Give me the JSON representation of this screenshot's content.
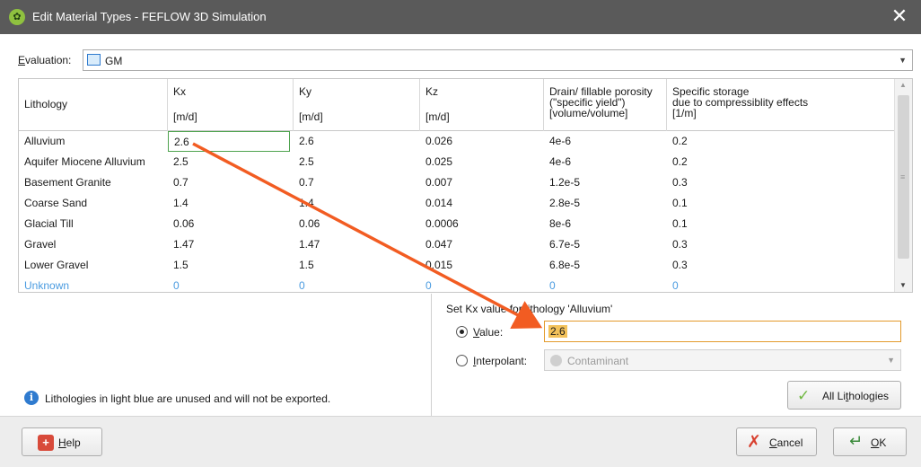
{
  "window": {
    "title": "Edit Material Types - FEFLOW 3D Simulation",
    "app_icon": "feflow-leaf-icon",
    "close_glyph": "✕"
  },
  "evaluation": {
    "label_mnemonic": "E",
    "label_rest": "valuation:",
    "value": "GM",
    "icon": "mesh-icon"
  },
  "table": {
    "headers": [
      {
        "line1": "Lithology",
        "line2": ""
      },
      {
        "line1": "Kx",
        "line2": "[m/d]"
      },
      {
        "line1": "Ky",
        "line2": "[m/d]"
      },
      {
        "line1": "Kz",
        "line2": "[m/d]"
      },
      {
        "line1": "Drain/ fillable porosity\n(\"specific yield\")\n[volume/volume]",
        "line2": ""
      },
      {
        "line1": "Specific storage\ndue to compressiblity effects\n[1/m]",
        "line2": ""
      }
    ],
    "rows": [
      {
        "cells": [
          "Alluvium",
          "2.6",
          "2.6",
          "0.026",
          "4e-6",
          "0.2"
        ],
        "unused": false,
        "selected_col": 1
      },
      {
        "cells": [
          "Aquifer Miocene Alluvium",
          "2.5",
          "2.5",
          "0.025",
          "4e-6",
          "0.2"
        ],
        "unused": false
      },
      {
        "cells": [
          "Basement Granite",
          "0.7",
          "0.7",
          "0.007",
          "1.2e-5",
          "0.3"
        ],
        "unused": false
      },
      {
        "cells": [
          "Coarse Sand",
          "1.4",
          "1.4",
          "0.014",
          "2.8e-5",
          "0.1"
        ],
        "unused": false
      },
      {
        "cells": [
          "Glacial Till",
          "0.06",
          "0.06",
          "0.0006",
          "8e-6",
          "0.1"
        ],
        "unused": false
      },
      {
        "cells": [
          "Gravel",
          "1.47",
          "1.47",
          "0.047",
          "6.7e-5",
          "0.3"
        ],
        "unused": false
      },
      {
        "cells": [
          "Lower Gravel",
          "1.5",
          "1.5",
          "0.015",
          "6.8e-5",
          "0.3"
        ],
        "unused": false
      },
      {
        "cells": [
          "Unknown",
          "0",
          "0",
          "0",
          "0",
          "0"
        ],
        "unused": true
      }
    ]
  },
  "set_value": {
    "heading": "Set Kx value for lithology 'Alluvium'",
    "value_mnemonic": "V",
    "value_rest": "alue:",
    "value_input": "2.6",
    "value_checked": true,
    "interp_mnemonic": "I",
    "interp_rest": "nterpolant:",
    "interp_value": "Contaminant",
    "interp_icon": "interpolant-icon",
    "all_lith_pre": "All Li",
    "all_lith_mnemonic": "t",
    "all_lith_post": "hologies"
  },
  "info": {
    "text": "Lithologies in light blue are unused and will not be exported."
  },
  "footer": {
    "help_mnemonic": "H",
    "help_rest": "elp",
    "cancel_mnemonic": "C",
    "cancel_rest": "ancel",
    "ok_mnemonic": "O",
    "ok_rest": "K"
  },
  "colors": {
    "title_bar": "#5a5a5a",
    "unused_text": "#4a9be0",
    "annotation_arrow": "#f25c22",
    "value_highlight": "#f3c25b",
    "selected_cell_border": "#4fa34f"
  }
}
